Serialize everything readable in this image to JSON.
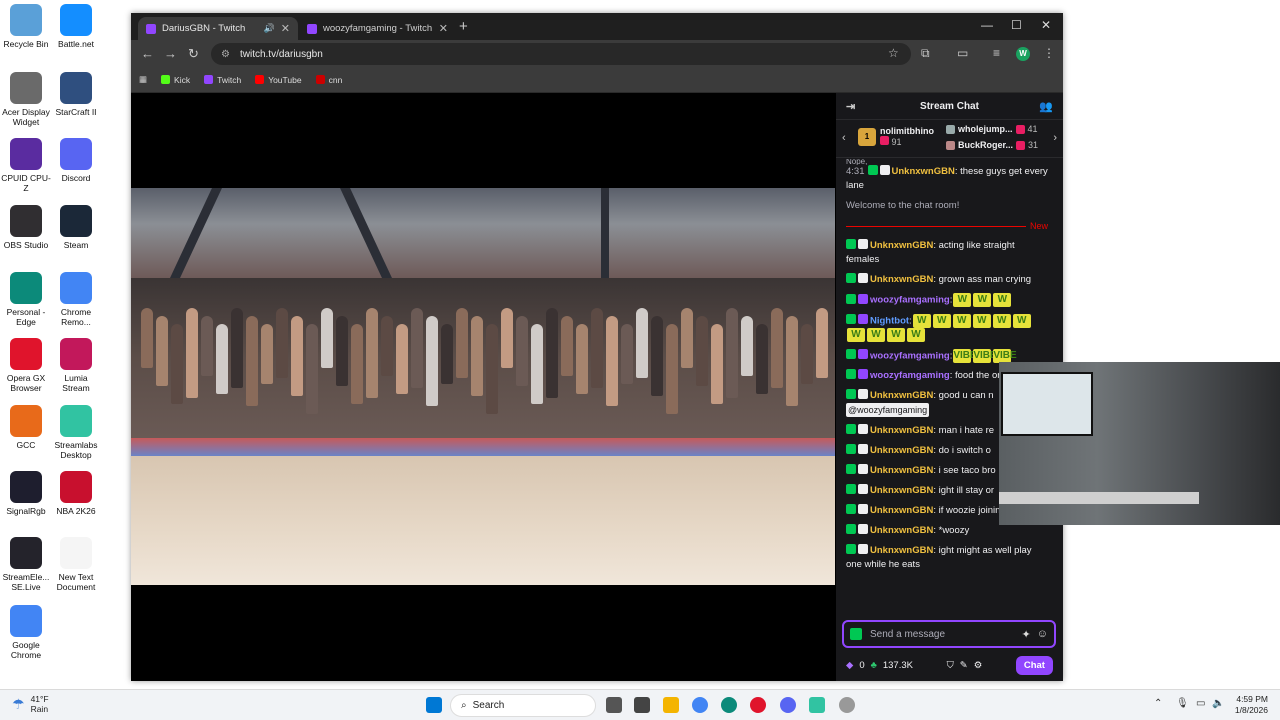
{
  "desktop": {
    "icons": [
      {
        "label": "Recycle Bin",
        "icon": "recycle-bin-icon",
        "color": "#5aa0d8"
      },
      {
        "label": "Battle.net",
        "icon": "battlenet-icon",
        "color": "#148eff"
      },
      {
        "label": "Acer Display Widget",
        "icon": "acer-icon",
        "color": "#6a6a6a"
      },
      {
        "label": "StarCraft II",
        "icon": "starcraft-icon",
        "color": "#2f4f7f"
      },
      {
        "label": "CPUID CPU-Z",
        "icon": "cpuz-icon",
        "color": "#5a2ca0"
      },
      {
        "label": "Discord",
        "icon": "discord-icon",
        "color": "#5865f2"
      },
      {
        "label": "OBS Studio",
        "icon": "obs-icon",
        "color": "#302e31"
      },
      {
        "label": "Steam",
        "icon": "steam-icon",
        "color": "#1b2838"
      },
      {
        "label": "Personal - Edge",
        "icon": "edge-icon",
        "color": "#0c8a7a"
      },
      {
        "label": "Chrome Remo...",
        "icon": "chrome-remote-icon",
        "color": "#4285f4"
      },
      {
        "label": "Opera GX Browser",
        "icon": "opera-gx-icon",
        "color": "#e0142c"
      },
      {
        "label": "Lumia Stream",
        "icon": "lumia-icon",
        "color": "#c2185b"
      },
      {
        "label": "GCC",
        "icon": "gcc-icon",
        "color": "#e86a1a"
      },
      {
        "label": "Streamlabs Desktop",
        "icon": "streamlabs-icon",
        "color": "#31c3a2"
      },
      {
        "label": "SignalRgb",
        "icon": "signalrgb-icon",
        "color": "#1e1e2e"
      },
      {
        "label": "NBA 2K26",
        "icon": "nba2k-icon",
        "color": "#c8102e"
      },
      {
        "label": "StreamEle... SE.Live",
        "icon": "streamelements-icon",
        "color": "#24232b"
      },
      {
        "label": "New Text Document",
        "icon": "text-document-icon",
        "color": "#f5f5f5"
      },
      {
        "label": "Google Chrome",
        "icon": "chrome-icon",
        "color": "#4285f4"
      }
    ]
  },
  "browser": {
    "tabs": [
      {
        "title": "DariusGBN - Twitch",
        "active": true
      },
      {
        "title": "woozyfamgaming - Twitch",
        "active": false
      }
    ],
    "url": "twitch.tv/dariusgbn",
    "profile_initial": "W",
    "bookmarks": [
      {
        "label": "Kick",
        "color": "#53fc18"
      },
      {
        "label": "Twitch",
        "color": "#9146ff"
      },
      {
        "label": "YouTube",
        "color": "#ff0000"
      },
      {
        "label": "cnn",
        "color": "#cc0000"
      }
    ]
  },
  "chat": {
    "header_title": "Stream Chat",
    "leaderboard": {
      "top": {
        "name": "nolimitbhino",
        "count": "91"
      },
      "second": {
        "name": "wholejump...",
        "count": "41"
      },
      "third": {
        "name": "BuckRoger...",
        "count": "31"
      }
    },
    "partial_top": "Nope,",
    "messages": [
      {
        "time": "4:31",
        "user": "UnknxwnGBN",
        "text": ": these guys get every lane",
        "user_class": "u1"
      }
    ],
    "welcome": "Welcome to the chat room!",
    "new_label": "New",
    "messages_after": [
      {
        "user": "UnknxwnGBN",
        "text": ": acting like straight females",
        "user_class": "u1"
      },
      {
        "user": "UnknxwnGBN",
        "text": ": grown ass man crying",
        "user_class": "u1"
      },
      {
        "user": "woozyfamgaming",
        "text": ":",
        "user_class": "u2",
        "emote_text": "W",
        "emotes": 3
      },
      {
        "user": "Nightbot",
        "text": ":",
        "user_class": "u3",
        "emote_text": "W",
        "emotes": 10
      },
      {
        "user": "woozyfamgaming",
        "text": ":",
        "user_class": "u2",
        "emote_text": "VIBE",
        "emotes": 3
      },
      {
        "user": "woozyfamgaming",
        "text": ": food the on",
        "user_class": "u2"
      },
      {
        "user": "UnknxwnGBN",
        "text": ": good u can n",
        "user_class": "u1",
        "mention": "@woozyfamgaming"
      },
      {
        "user": "UnknxwnGBN",
        "text": ": man i hate re",
        "user_class": "u1"
      },
      {
        "user": "UnknxwnGBN",
        "text": ": do i switch o",
        "user_class": "u1"
      },
      {
        "user": "UnknxwnGBN",
        "text": ": i see taco bro",
        "user_class": "u1"
      },
      {
        "user": "UnknxwnGBN",
        "text": ": ight ill stay or",
        "user_class": "u1"
      },
      {
        "user": "UnknxwnGBN",
        "text": ": if woozie joinin ill switch",
        "user_class": "u1"
      },
      {
        "user": "UnknxwnGBN",
        "text": ": *woozy",
        "user_class": "u1"
      },
      {
        "user": "UnknxwnGBN",
        "text": ": ight might as well play one while he eats",
        "user_class": "u1"
      }
    ],
    "input_placeholder": "Send a message",
    "bits": "0",
    "points": "137.3K",
    "chat_button": "Chat"
  },
  "taskbar": {
    "weather_temp": "41°F",
    "weather_cond": "Rain",
    "search_label": "Search",
    "time": "4:59 PM",
    "date": "1/8/2026"
  }
}
